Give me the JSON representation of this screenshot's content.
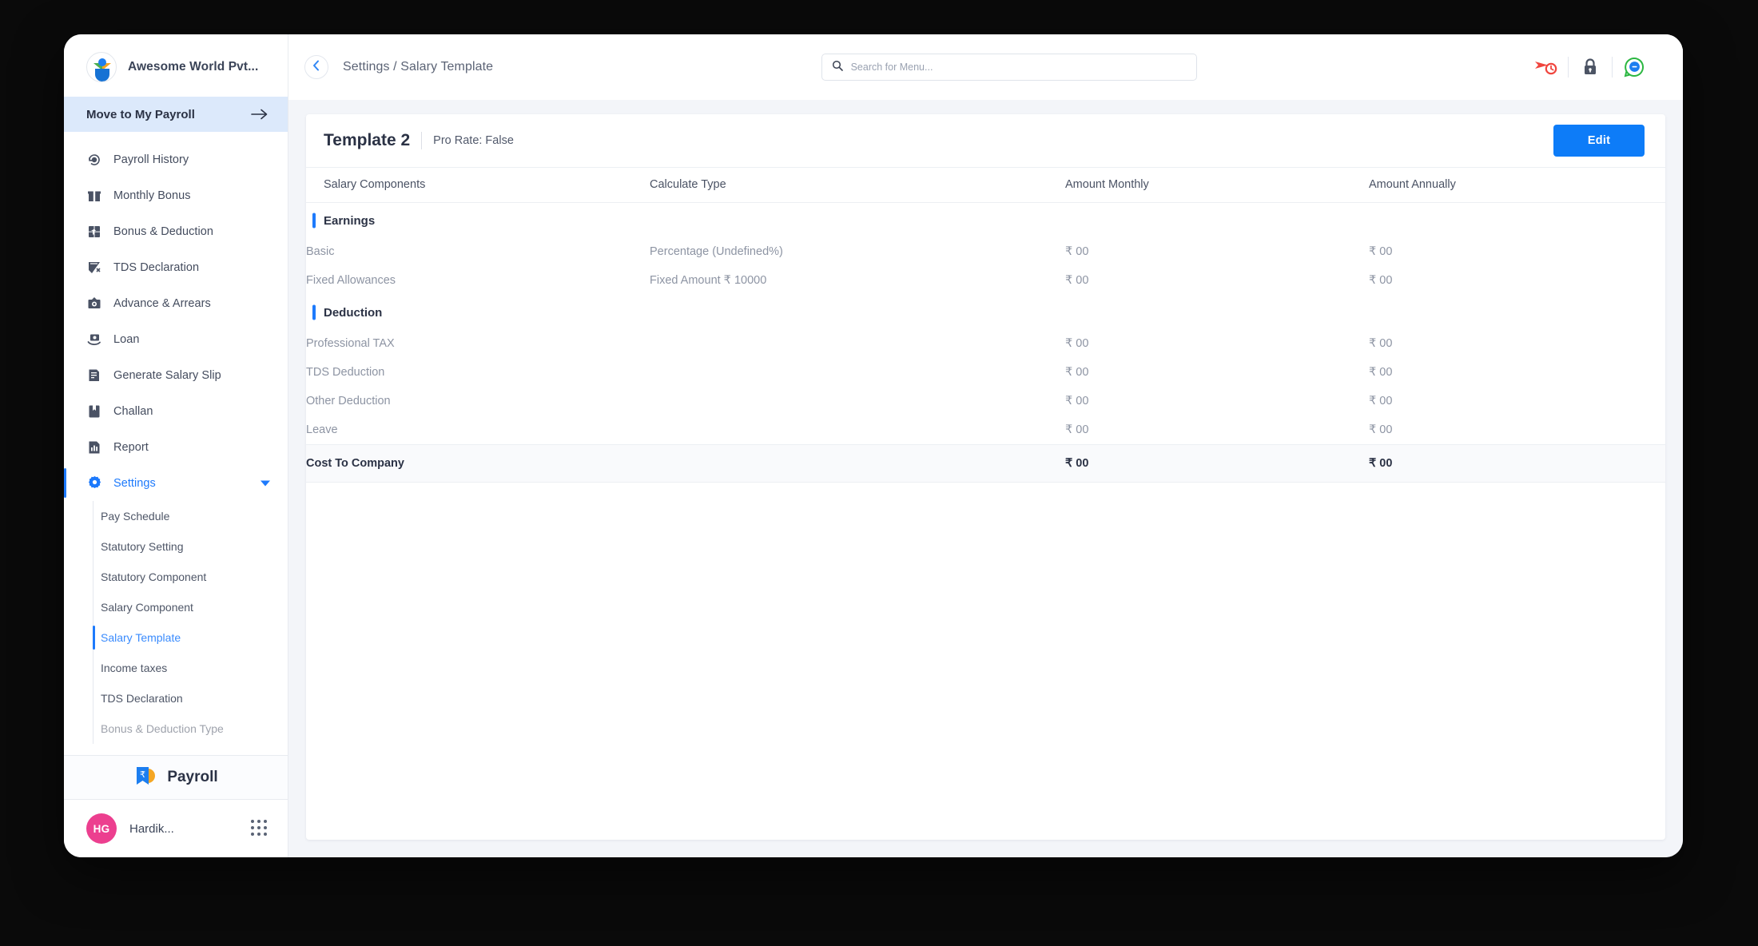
{
  "brand": {
    "name": "Awesome World Pvt...",
    "logo_icon": "company-logo-icon"
  },
  "sidebar": {
    "move_to_payroll": {
      "label": "Move to My Payroll",
      "icon": "arrow-right-icon"
    },
    "items": [
      {
        "label": "Payroll History",
        "icon": "payroll-history-icon"
      },
      {
        "label": "Monthly Bonus",
        "icon": "gift-icon"
      },
      {
        "label": "Bonus & Deduction",
        "icon": "bonus-deduction-icon"
      },
      {
        "label": "TDS Declaration",
        "icon": "tds-declaration-icon"
      },
      {
        "label": "Advance & Arrears",
        "icon": "advance-arrears-icon"
      },
      {
        "label": "Loan",
        "icon": "loan-icon"
      },
      {
        "label": "Generate Salary Slip",
        "icon": "salary-slip-icon"
      },
      {
        "label": "Challan",
        "icon": "challan-icon"
      },
      {
        "label": "Report",
        "icon": "report-icon"
      },
      {
        "label": "Settings",
        "icon": "gear-icon",
        "active": true,
        "expanded": true
      }
    ],
    "settings_children": [
      {
        "label": "Pay Schedule"
      },
      {
        "label": "Statutory Setting"
      },
      {
        "label": "Statutory Component"
      },
      {
        "label": "Salary Component"
      },
      {
        "label": "Salary Template",
        "active": true
      },
      {
        "label": "Income taxes"
      },
      {
        "label": "TDS Declaration"
      },
      {
        "label": "Bonus & Deduction Type"
      }
    ],
    "payroll_bar": {
      "label": "Payroll",
      "icon": "payroll-rupee-icon"
    },
    "user": {
      "initials": "HG",
      "name": "Hardik...",
      "apps_icon": "grid-apps-icon"
    }
  },
  "topbar": {
    "back_icon": "chevron-left-icon",
    "breadcrumb": "Settings / Salary Template",
    "search": {
      "placeholder": "Search for Menu...",
      "value": "",
      "icon": "search-icon"
    },
    "icons": [
      {
        "name": "time-tracker-icon",
        "color": "#f0453e"
      },
      {
        "name": "lock-icon",
        "color": "#4c5464"
      },
      {
        "name": "chat-support-icon",
        "color": "#2cb742"
      }
    ]
  },
  "panel": {
    "title": "Template 2",
    "subtitle": "Pro Rate: False",
    "edit_label": "Edit",
    "columns": [
      "Salary Components",
      "Calculate Type",
      "Amount Monthly",
      "Amount Annually"
    ],
    "sections": [
      {
        "group": "Earnings",
        "rows": [
          {
            "component": "Basic",
            "calculate_type": "Percentage (Undefined%)",
            "amount_monthly": "₹ 00",
            "amount_annually": "₹ 00"
          },
          {
            "component": "Fixed Allowances",
            "calculate_type": "Fixed Amount ₹ 10000",
            "amount_monthly": "₹ 00",
            "amount_annually": "₹ 00"
          }
        ]
      },
      {
        "group": "Deduction",
        "rows": [
          {
            "component": "Professional TAX",
            "calculate_type": "",
            "amount_monthly": "₹ 00",
            "amount_annually": "₹ 00"
          },
          {
            "component": "TDS Deduction",
            "calculate_type": "",
            "amount_monthly": "₹ 00",
            "amount_annually": "₹ 00"
          },
          {
            "component": "Other Deduction",
            "calculate_type": "",
            "amount_monthly": "₹ 00",
            "amount_annually": "₹ 00"
          },
          {
            "component": "Leave",
            "calculate_type": "",
            "amount_monthly": "₹ 00",
            "amount_annually": "₹ 00"
          }
        ]
      }
    ],
    "total": {
      "component": "Cost To Company",
      "calculate_type": "",
      "amount_monthly": "₹ 00",
      "amount_annually": "₹ 00"
    }
  },
  "colors": {
    "accent": "#1d7afc",
    "highlight": "#dce9fb",
    "avatar": "#ec3f8f",
    "page_bg": "#0a0a0a"
  }
}
